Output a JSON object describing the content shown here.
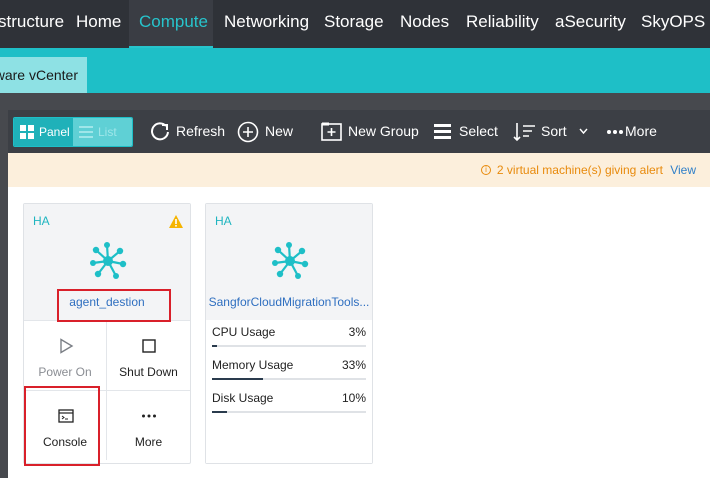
{
  "topnav": {
    "brand": "structure",
    "items": [
      {
        "label": "Home"
      },
      {
        "label": "Compute"
      },
      {
        "label": "Networking"
      },
      {
        "label": "Storage"
      },
      {
        "label": "Nodes"
      },
      {
        "label": "Reliability"
      },
      {
        "label": "aSecurity"
      },
      {
        "label": "SkyOPS"
      }
    ],
    "active": "Compute"
  },
  "subnav": {
    "tab_label": "ware vCenter"
  },
  "toolbar": {
    "view_panel": "Panel",
    "view_list": "List",
    "refresh": "Refresh",
    "new": "New",
    "new_group": "New Group",
    "select": "Select",
    "sort": "Sort",
    "more": "More"
  },
  "alert": {
    "message": "2 virtual machine(s) giving alert",
    "view": "View",
    "icon": "info-circle-icon"
  },
  "vms": [
    {
      "group": "HA",
      "name": "agent_destion",
      "warning": true,
      "actions": {
        "power_on": "Power On",
        "shut_down": "Shut Down",
        "console": "Console",
        "more": "More"
      }
    },
    {
      "group": "HA",
      "name": "SangforCloudMigrationTools...",
      "metrics": [
        {
          "label": "CPU Usage",
          "value": "3%",
          "fraction": 0.03
        },
        {
          "label": "Memory Usage",
          "value": "33%",
          "fraction": 0.33
        },
        {
          "label": "Disk Usage",
          "value": "10%",
          "fraction": 0.1
        }
      ]
    }
  ],
  "colors": {
    "accent": "#1ebfc7",
    "nav_bg": "#2f3238",
    "toolbar_bg": "#3c3f45",
    "warning": "#f5b400",
    "highlight_box": "#d9202a",
    "link": "#2f6fc0"
  }
}
